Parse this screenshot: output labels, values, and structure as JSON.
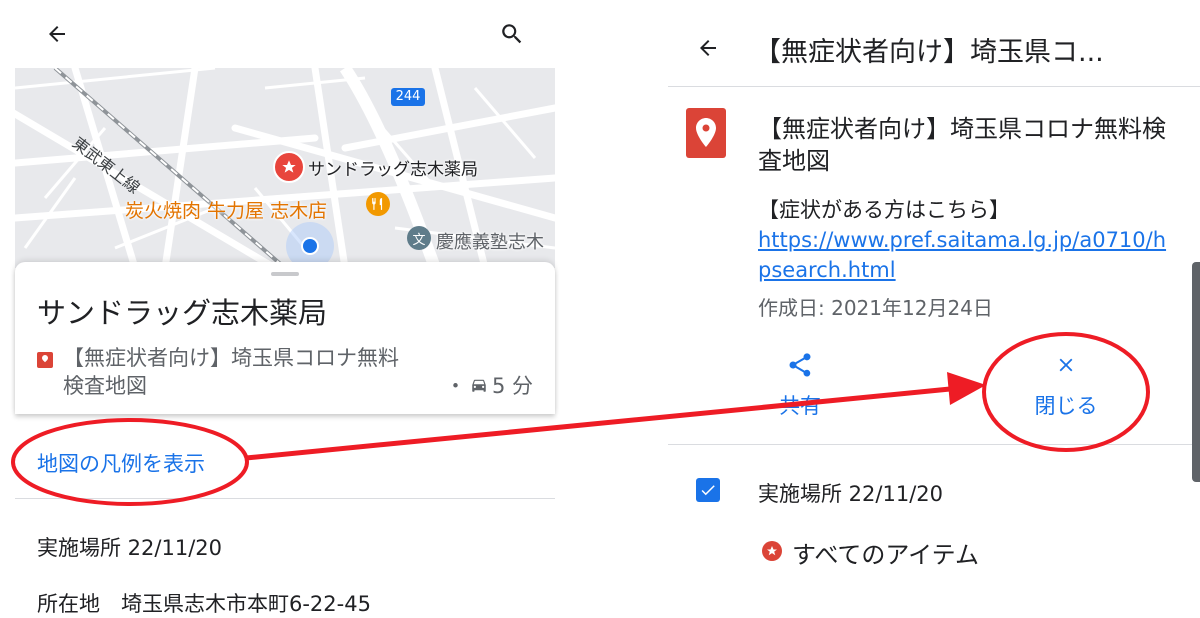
{
  "left": {
    "map": {
      "road_number": "244",
      "rail_line": "東武東上線",
      "poi_pharmacy": "サンドラッグ志木薬局",
      "poi_restaurant": "炭火焼肉 牛力屋 志木店",
      "poi_school": "慶應義塾志木",
      "school_icon_char": "文"
    },
    "sheet": {
      "place_name": "サンドラッグ志木薬局",
      "layer_line1": "【無症状者向け】埼玉県コロナ無料",
      "layer_line2": "検査地図",
      "eta_prefix": "・",
      "eta_text": "5 分"
    },
    "legend_link": "地図の凡例を表示",
    "info": {
      "implementation": "実施場所 22/11/20",
      "address": "所在地　埼玉県志木市本町6-22-45"
    }
  },
  "right": {
    "header_title": "【無症状者向け】埼玉県コ...",
    "detail": {
      "title": "【無症状者向け】埼玉県コロナ無料検査地図",
      "desc_line": "【症状がある方はこちら】",
      "link": "https://www.pref.saitama.lg.jp/a0710/hpsearch.html",
      "created": "作成日: 2021年12月24日"
    },
    "actions": {
      "share": "共有",
      "close": "閉じる"
    },
    "layer": {
      "name": "実施場所 22/11/20",
      "checked": true,
      "all_items": "すべてのアイテム"
    }
  },
  "colors": {
    "accent": "#1a73e8",
    "pin": "#db4437",
    "annotation": "#ee1c25"
  },
  "icons": [
    "back-arrow-icon",
    "search-icon",
    "map-pin-icon",
    "car-icon",
    "share-icon",
    "close-icon",
    "checkbox-icon",
    "star-icon",
    "restaurant-icon",
    "school-icon",
    "location-dot-icon"
  ]
}
